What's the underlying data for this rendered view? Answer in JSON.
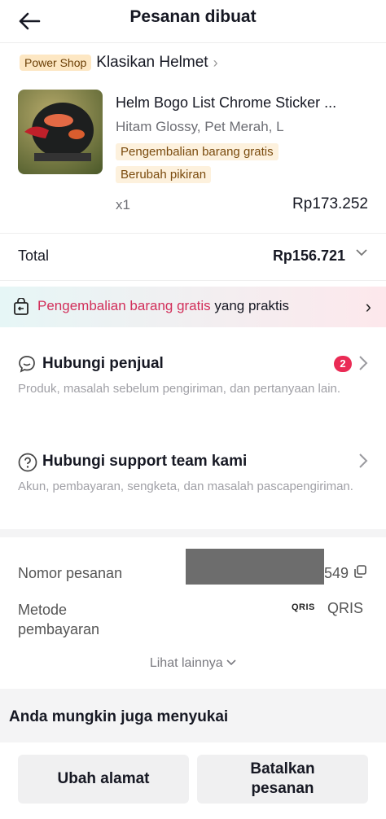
{
  "header": {
    "title": "Pesanan dibuat",
    "back_icon": "arrow-left-icon"
  },
  "shop": {
    "badge": "Power Shop",
    "name": "Klasikan Helmet"
  },
  "product": {
    "name": "Helm Bogo List Chrome Sticker ...",
    "variant": "Hitam Glossy, Pet Merah, L",
    "tags": [
      "Pengembalian barang gratis",
      "Berubah pikiran"
    ],
    "quantity": "x1",
    "price": "Rp173.252"
  },
  "total": {
    "label": "Total",
    "value": "Rp156.721"
  },
  "returns_banner": {
    "highlight": "Pengembalian barang gratis",
    "rest": " yang praktis"
  },
  "contact_seller": {
    "title": "Hubungi penjual",
    "description": "Produk, masalah sebelum pengiriman, dan pertanyaan lain.",
    "badge_count": "2"
  },
  "contact_support": {
    "title": "Hubungi support team kami",
    "description": "Akun, pembayaran, sengketa, dan masalah pascapengiriman."
  },
  "order_info": {
    "order_number_label": "Nomor pesanan",
    "order_number_suffix": "549",
    "payment_label": "Metode pembayaran",
    "payment_logo": "QRIS",
    "payment_value": "QRIS",
    "see_more": "Lihat lainnya"
  },
  "recommendations": {
    "title": "Anda mungkin juga menyukai"
  },
  "actions": {
    "change_address": "Ubah alamat",
    "cancel_order": "Batalkan pesanan"
  },
  "colors": {
    "accent_pink": "#d22f5a",
    "badge_red": "#ea2b55",
    "badge_bg": "#fde7c3"
  }
}
